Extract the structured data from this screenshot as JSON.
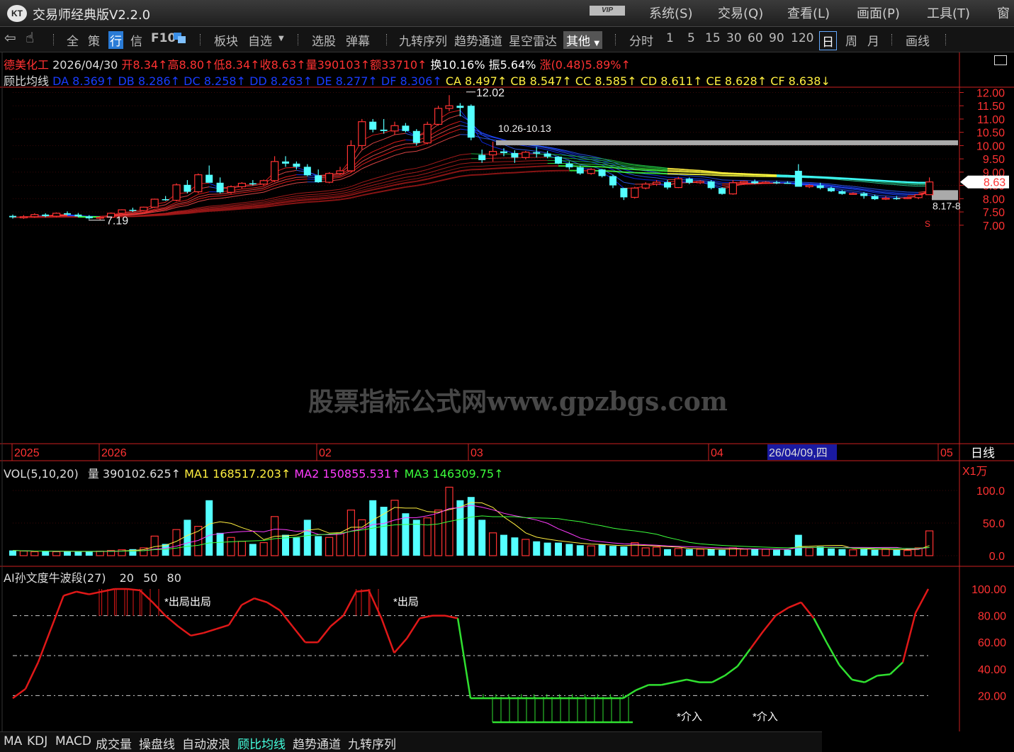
{
  "app": {
    "title": "交易师经典版V2.2.0",
    "logo": "KT",
    "vip": "VIP"
  },
  "menu": [
    "系统(S)",
    "交易(Q)",
    "查看(L)",
    "画面(P)",
    "工具(T)",
    "窗"
  ],
  "toolbar": {
    "groupA": [
      "全",
      "策",
      "行",
      "信",
      "F10"
    ],
    "groupB": [
      "板块",
      "自选"
    ],
    "groupC": [
      "选股",
      "弹幕"
    ],
    "groupD": [
      "九转序列",
      "趋势通道",
      "星空雷达"
    ],
    "dropdown": "其他",
    "periods": [
      "分时",
      "1",
      "5",
      "15",
      "30",
      "60",
      "90",
      "120",
      "日",
      "周",
      "月"
    ],
    "active_period": "日",
    "draw": "画线"
  },
  "stock": {
    "name": "德美化工",
    "date": "2026/04/30",
    "open": "开8.34↑",
    "high": "高8.80↑",
    "low": "低8.34↑",
    "close": "收8.63↑",
    "vol": "量390103↑",
    "amount": "额33710↑",
    "turnover": "换10.16%",
    "amplitude": "振5.64%",
    "change": "涨(0.48)5.89%↑"
  },
  "guppy": {
    "name": "顾比均线",
    "short": [
      "DA 8.369↑",
      "DB 8.286↑",
      "DC 8.258↑",
      "DD 8.263↑",
      "DE 8.277↑",
      "DF 8.306↑"
    ],
    "long": [
      "CA 8.497↑",
      "CB 8.547↑",
      "CC 8.585↑",
      "CD 8.611↑",
      "CE 8.628↑",
      "CF 8.638↓"
    ]
  },
  "price_axis": {
    "ticks": [
      "12.00",
      "11.50",
      "11.00",
      "10.50",
      "10.00",
      "9.50",
      "9.00",
      "8.50",
      "8.00",
      "7.50",
      "7.00"
    ],
    "current": "8.63",
    "colors": {
      "up": "#ff3232",
      "down": "#54ffff",
      "axis": "#cc2020"
    }
  },
  "annotations": {
    "high": "12.02",
    "low": "7.19",
    "band": "10.26-10.13",
    "band_right": "8.17-8",
    "s_mark": "S"
  },
  "date_axis": {
    "labels": [
      "2025",
      "2026",
      "02",
      "03",
      "04",
      "05"
    ],
    "cursor": "26/04/09,四",
    "period_label": "日线"
  },
  "volume": {
    "name": "VOL(5,10,20)",
    "current": "量 390102.625↑",
    "ma1": "MA1 168517.203↑",
    "ma2": "MA2 150855.531↑",
    "ma3": "MA3 146309.75↑",
    "scale": "X1万",
    "ticks": [
      "100.0",
      "50.0",
      "0.0"
    ]
  },
  "indicator": {
    "name": "AI孙文度牛波段(27)",
    "params": [
      "20",
      "50",
      "80"
    ],
    "ticks": [
      "100.00",
      "80.00",
      "60.00",
      "40.00",
      "20.00"
    ],
    "labels": {
      "exit1": "出局出局",
      "exit2": "出局",
      "enter1": "介入",
      "enter2": "介入"
    }
  },
  "bottom_tabs": [
    "MA",
    "KDJ",
    "MACD",
    "成交量",
    "操盘线",
    "自动波浪",
    "顾比均线",
    "趋势通道",
    "九转序列"
  ],
  "active_tab": "顾比均线",
  "watermark": "股票指标公式网www.gpzbgs.com",
  "candles": [
    [
      7.35,
      7.4,
      7.25,
      7.3
    ],
    [
      7.3,
      7.38,
      7.24,
      7.32
    ],
    [
      7.32,
      7.45,
      7.28,
      7.4
    ],
    [
      7.4,
      7.45,
      7.3,
      7.34
    ],
    [
      7.34,
      7.48,
      7.3,
      7.45
    ],
    [
      7.45,
      7.52,
      7.38,
      7.4
    ],
    [
      7.4,
      7.46,
      7.3,
      7.33
    ],
    [
      7.33,
      7.38,
      7.22,
      7.26
    ],
    [
      7.26,
      7.35,
      7.19,
      7.3
    ],
    [
      7.3,
      7.48,
      7.28,
      7.45
    ],
    [
      7.45,
      7.6,
      7.42,
      7.58
    ],
    [
      7.58,
      7.66,
      7.5,
      7.55
    ],
    [
      7.55,
      7.7,
      7.52,
      7.68
    ],
    [
      7.68,
      8.0,
      7.65,
      7.98
    ],
    [
      7.98,
      8.1,
      7.92,
      7.94
    ],
    [
      7.94,
      8.58,
      7.9,
      8.52
    ],
    [
      8.52,
      8.7,
      8.2,
      8.26
    ],
    [
      8.26,
      8.95,
      8.2,
      8.9
    ],
    [
      8.9,
      9.25,
      8.8,
      8.6
    ],
    [
      8.6,
      8.8,
      8.2,
      8.24
    ],
    [
      8.24,
      8.5,
      8.18,
      8.45
    ],
    [
      8.45,
      8.62,
      8.38,
      8.58
    ],
    [
      8.58,
      8.7,
      8.5,
      8.55
    ],
    [
      8.55,
      8.72,
      8.48,
      8.68
    ],
    [
      8.68,
      9.6,
      8.62,
      9.4
    ],
    [
      9.4,
      9.6,
      9.2,
      9.32
    ],
    [
      9.32,
      9.4,
      9.1,
      9.2
    ],
    [
      9.2,
      9.3,
      8.85,
      8.88
    ],
    [
      8.88,
      9.1,
      8.6,
      8.62
    ],
    [
      8.62,
      9.0,
      8.58,
      8.95
    ],
    [
      8.95,
      9.2,
      8.9,
      9.05
    ],
    [
      9.05,
      10.2,
      9.0,
      10.0
    ],
    [
      10.0,
      11.0,
      9.85,
      10.9
    ],
    [
      10.9,
      11.0,
      10.5,
      10.6
    ],
    [
      10.6,
      11.0,
      10.45,
      10.55
    ],
    [
      10.55,
      10.9,
      10.4,
      10.75
    ],
    [
      10.75,
      10.85,
      10.5,
      10.55
    ],
    [
      10.55,
      10.62,
      10.0,
      10.1
    ],
    [
      10.1,
      10.9,
      10.05,
      10.8
    ],
    [
      10.8,
      11.5,
      10.75,
      11.4
    ],
    [
      11.4,
      11.9,
      11.3,
      11.5
    ],
    [
      11.5,
      11.6,
      11.1,
      11.42
    ],
    [
      11.5,
      11.55,
      10.2,
      10.3
    ],
    [
      9.65,
      9.85,
      9.35,
      9.45
    ],
    [
      9.65,
      10.15,
      9.4,
      9.78
    ],
    [
      9.78,
      9.9,
      9.6,
      9.72
    ],
    [
      9.72,
      9.82,
      9.35,
      9.55
    ],
    [
      9.55,
      9.8,
      9.48,
      9.75
    ],
    [
      9.75,
      9.95,
      9.55,
      9.7
    ],
    [
      9.7,
      9.8,
      9.52,
      9.58
    ],
    [
      9.58,
      9.6,
      9.3,
      9.32
    ],
    [
      9.32,
      9.4,
      9.1,
      9.18
    ],
    [
      9.18,
      9.25,
      8.9,
      8.95
    ],
    [
      8.95,
      9.15,
      8.9,
      9.1
    ],
    [
      9.1,
      9.12,
      8.8,
      8.85
    ],
    [
      8.85,
      8.9,
      8.4,
      8.5
    ],
    [
      8.4,
      8.4,
      7.95,
      8.05
    ],
    [
      8.05,
      8.45,
      8.0,
      8.4
    ],
    [
      8.4,
      8.62,
      8.35,
      8.55
    ],
    [
      8.55,
      8.7,
      8.48,
      8.62
    ],
    [
      8.62,
      8.7,
      8.35,
      8.42
    ],
    [
      8.42,
      8.82,
      8.4,
      8.75
    ],
    [
      8.75,
      8.8,
      8.55,
      8.6
    ],
    [
      8.6,
      8.7,
      8.55,
      8.65
    ],
    [
      8.65,
      8.7,
      8.35,
      8.4
    ],
    [
      8.4,
      8.42,
      8.15,
      8.18
    ],
    [
      8.18,
      8.7,
      8.15,
      8.6
    ],
    [
      8.6,
      8.68,
      8.52,
      8.65
    ],
    [
      8.65,
      8.72,
      8.55,
      8.58
    ],
    [
      8.58,
      8.66,
      8.56,
      8.62
    ],
    [
      8.62,
      8.68,
      8.55,
      8.6
    ],
    [
      8.6,
      8.66,
      8.56,
      8.58
    ],
    [
      9.05,
      9.3,
      8.8,
      8.45
    ],
    [
      8.45,
      8.55,
      8.4,
      8.5
    ],
    [
      8.5,
      8.6,
      8.35,
      8.4
    ],
    [
      8.4,
      8.45,
      8.25,
      8.28
    ],
    [
      8.28,
      8.32,
      8.15,
      8.18
    ],
    [
      8.18,
      8.24,
      8.15,
      8.2
    ],
    [
      8.2,
      8.25,
      8.0,
      8.1
    ],
    [
      8.1,
      8.15,
      7.95,
      7.98
    ],
    [
      7.98,
      8.1,
      7.95,
      8.02
    ],
    [
      8.02,
      8.1,
      7.96,
      8.0
    ],
    [
      8.0,
      8.08,
      7.98,
      8.04
    ],
    [
      8.04,
      8.12,
      7.98,
      8.15
    ],
    [
      8.15,
      8.8,
      8.34,
      8.63
    ]
  ],
  "volumes": [
    8,
    7,
    6,
    7,
    6,
    7,
    6,
    6,
    7,
    8,
    9,
    10,
    12,
    30,
    18,
    40,
    55,
    45,
    85,
    35,
    28,
    22,
    18,
    20,
    60,
    32,
    28,
    55,
    30,
    28,
    35,
    70,
    55,
    85,
    75,
    85,
    65,
    55,
    58,
    70,
    105,
    85,
    90,
    55,
    35,
    32,
    28,
    25,
    22,
    20,
    20,
    18,
    16,
    15,
    17,
    15,
    14,
    20,
    12,
    13,
    10,
    11,
    10,
    10,
    10,
    9,
    12,
    10,
    10,
    10,
    9,
    9,
    32,
    12,
    14,
    11,
    10,
    9,
    10,
    9,
    10,
    9,
    8,
    12,
    38
  ],
  "indicator_series": [
    18,
    25,
    45,
    70,
    95,
    98,
    96,
    98,
    100,
    100,
    99,
    90,
    80,
    72,
    65,
    67,
    70,
    73,
    88,
    93,
    90,
    84,
    72,
    60,
    60,
    72,
    80,
    98,
    99,
    78,
    52,
    63,
    78,
    80,
    80,
    78,
    18,
    18,
    18,
    18,
    18,
    18,
    18,
    18,
    18,
    18,
    18,
    18,
    18,
    24,
    28,
    28,
    30,
    32,
    30,
    30,
    35,
    42,
    55,
    68,
    80,
    86,
    90,
    78,
    60,
    43,
    32,
    30,
    35,
    36,
    45,
    82,
    100
  ]
}
